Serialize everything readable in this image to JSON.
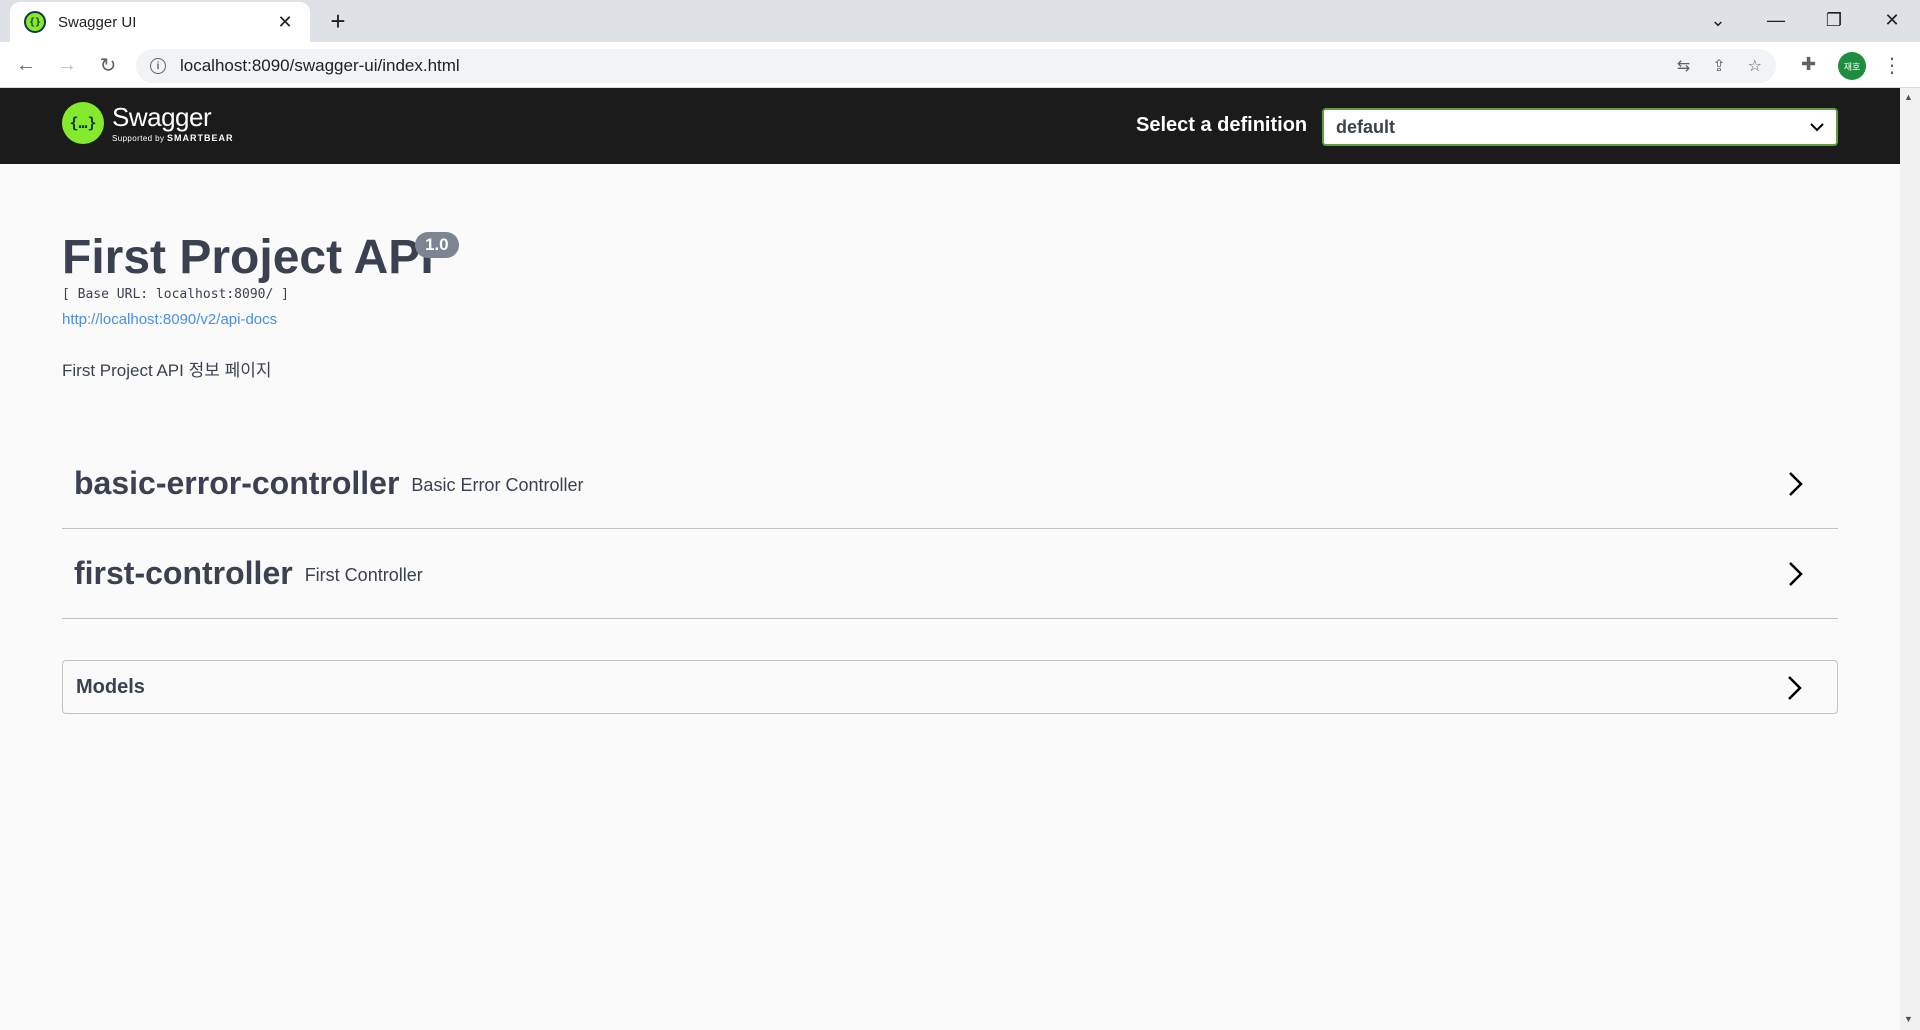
{
  "browser": {
    "tab_title": "Swagger UI",
    "tab_favicon": "swagger-favicon",
    "new_tab": "+",
    "url": "localhost:8090/swagger-ui/index.html",
    "profile_initials": "재호"
  },
  "swagger": {
    "logo_name": "Swagger",
    "logo_sub_prefix": "Supported by",
    "logo_sub_brand": "SMARTBEAR",
    "definition_label": "Select a definition",
    "definition_value": "default"
  },
  "info": {
    "title": "First Project API",
    "version": "1.0",
    "base_url": "[ Base URL: localhost:8090/ ]",
    "api_docs_link": "http://localhost:8090/v2/api-docs",
    "description": "First Project API 정보 페이지"
  },
  "tags": [
    {
      "name": "basic-error-controller",
      "description": "Basic Error Controller"
    },
    {
      "name": "first-controller",
      "description": "First Controller"
    }
  ],
  "models": {
    "title": "Models"
  },
  "colors": {
    "swagger_green": "#85ea2d",
    "topbar_bg": "#1b1b1b",
    "text": "#3b4151",
    "link": "#4990e2",
    "badge": "#7d8492"
  }
}
